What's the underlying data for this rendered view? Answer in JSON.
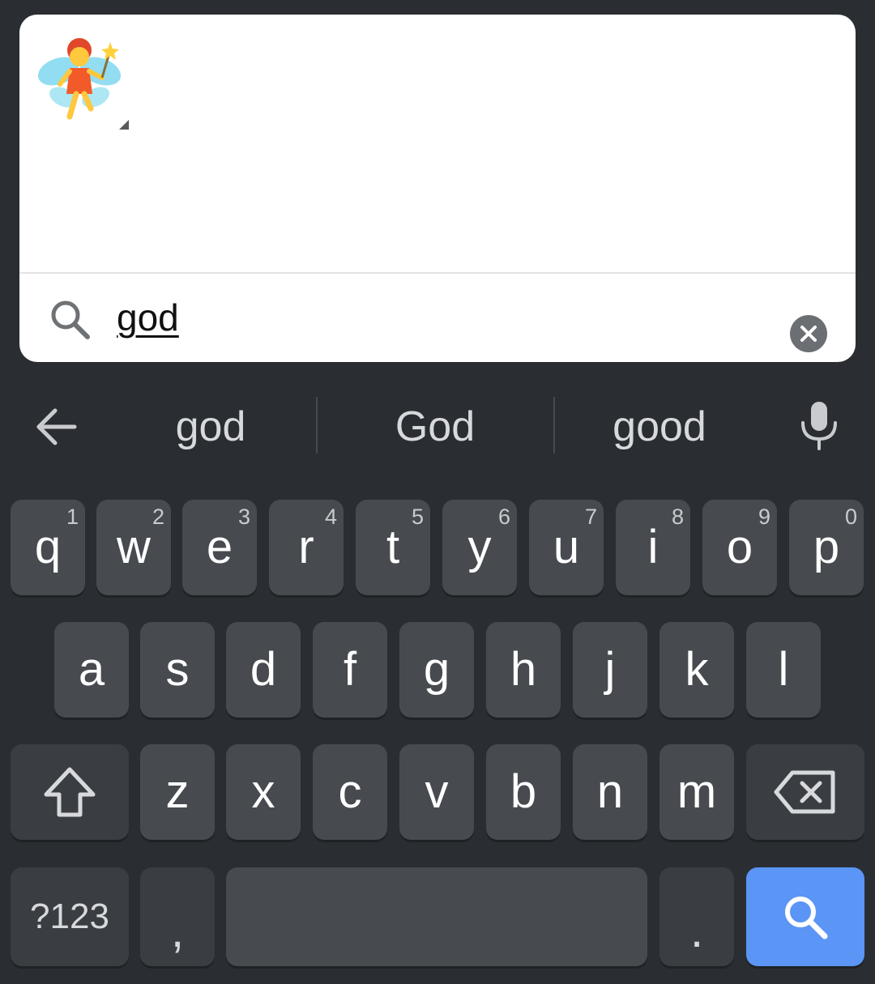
{
  "emoji_panel": {
    "result_emoji": "🧚",
    "search": {
      "query": "god",
      "search_icon": "search-icon",
      "clear_icon": "clear-circle-icon"
    }
  },
  "suggestion_strip": {
    "back_icon": "arrow-back-icon",
    "suggestions": [
      "god",
      "God",
      "good"
    ],
    "mic_icon": "microphone-icon"
  },
  "keyboard": {
    "row1": [
      {
        "letter": "q",
        "num": "1"
      },
      {
        "letter": "w",
        "num": "2"
      },
      {
        "letter": "e",
        "num": "3"
      },
      {
        "letter": "r",
        "num": "4"
      },
      {
        "letter": "t",
        "num": "5"
      },
      {
        "letter": "y",
        "num": "6"
      },
      {
        "letter": "u",
        "num": "7"
      },
      {
        "letter": "i",
        "num": "8"
      },
      {
        "letter": "o",
        "num": "9"
      },
      {
        "letter": "p",
        "num": "0"
      }
    ],
    "row2": [
      "a",
      "s",
      "d",
      "f",
      "g",
      "h",
      "j",
      "k",
      "l"
    ],
    "row3": [
      "z",
      "x",
      "c",
      "v",
      "b",
      "n",
      "m"
    ],
    "symbols_label": "?123",
    "comma": ",",
    "period": ".",
    "shift_icon": "shift-icon",
    "backspace_icon": "backspace-icon",
    "action_icon": "search-icon"
  },
  "colors": {
    "background": "#2a2e33",
    "key": "#474b50",
    "action_key": "#5b95f5"
  }
}
